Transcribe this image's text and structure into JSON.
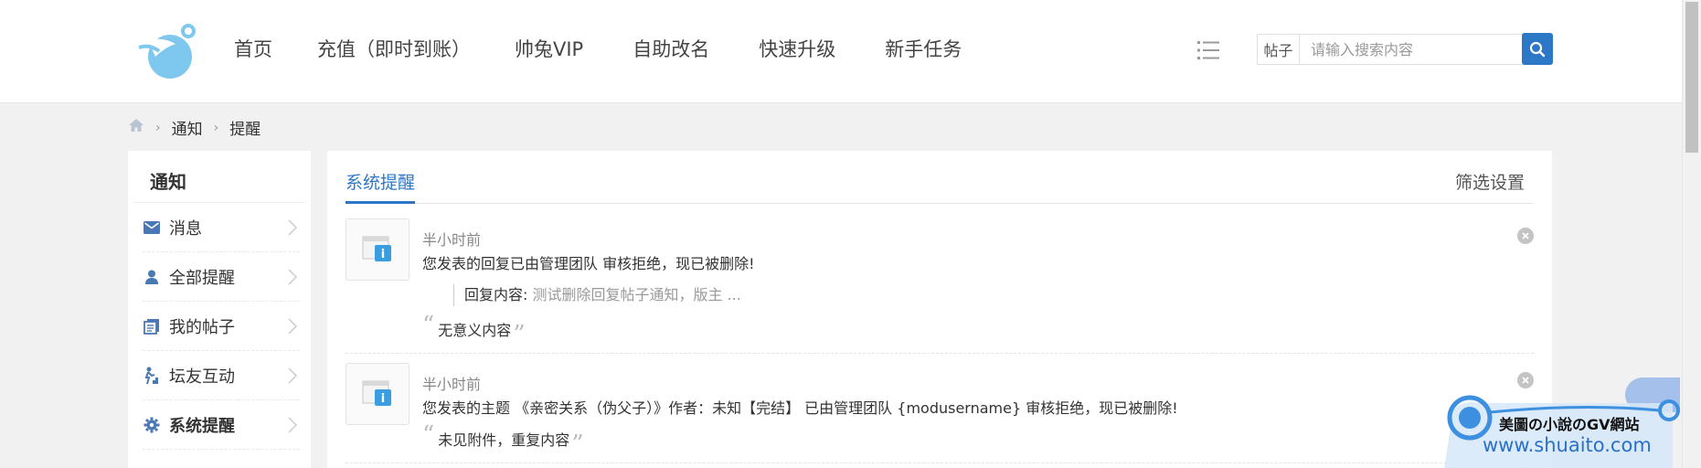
{
  "header": {
    "nav": [
      "首页",
      "充值（即时到账）",
      "帅兔VIP",
      "自助改名",
      "快速升级",
      "新手任务"
    ],
    "search": {
      "type_label": "帖子",
      "placeholder": "请输入搜索内容"
    }
  },
  "breadcrumb": {
    "items": [
      "通知",
      "提醒"
    ]
  },
  "sidebar": {
    "title": "通知",
    "items": [
      {
        "label": "消息",
        "icon": "mail-icon"
      },
      {
        "label": "全部提醒",
        "icon": "person-icon"
      },
      {
        "label": "我的帖子",
        "icon": "posts-icon"
      },
      {
        "label": "坛友互动",
        "icon": "interaction-icon"
      },
      {
        "label": "系统提醒",
        "icon": "gear-icon",
        "active": true
      }
    ]
  },
  "main": {
    "tab_label": "系统提醒",
    "filter_label": "筛选设置",
    "notices": [
      {
        "time": "半小时前",
        "text": "您发表的回复已由管理团队 审核拒绝，现已被删除!",
        "reply_label": "回复内容:",
        "reply_value": "测试删除回复帖子通知，版主 ...",
        "reason": "无意义内容"
      },
      {
        "time": "半小时前",
        "text": "您发表的主题 《亲密关系（伪父子）》作者：未知【完结】 已由管理团队 {modusername} 审核拒绝，现已被删除!",
        "reason": "未见附件，重复内容"
      }
    ]
  },
  "watermark": {
    "line1": "美圖の小說のGV網站",
    "line2": "www.shuaito.com"
  },
  "colors": {
    "accent": "#2d77c7",
    "watermark": "#3d8fe0"
  }
}
